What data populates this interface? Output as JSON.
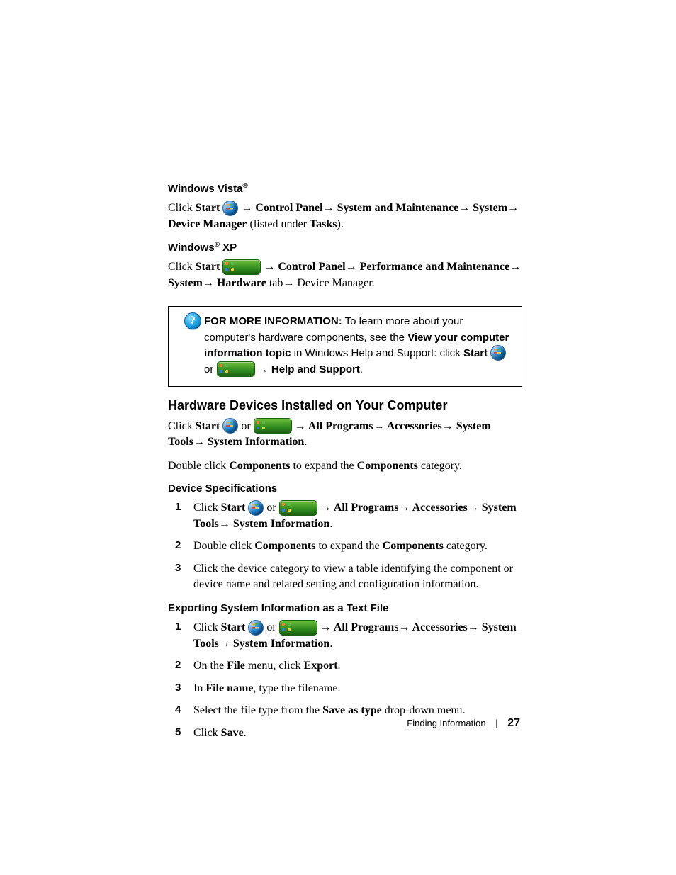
{
  "sections": {
    "vista_heading": "Windows Vista",
    "reg": "®",
    "click": "Click ",
    "start_bold": "Start",
    "vista_path": " → Control Panel→ System and Maintenance→ System→ Device Manager",
    "vista_tail": " (listed under ",
    "tasks_bold": "Tasks",
    "vista_tail2": ").",
    "xp_heading_pre": "Windows",
    "xp_heading_post": " XP",
    "xp_path1": " → Control Panel→ Performance and Maintenance→ System→ ",
    "hardware_bold": "Hardware",
    "xp_tab": " tab→ Device Manager."
  },
  "infobox": {
    "lead_bold": "FOR MORE INFORMATION:",
    "text1": " To learn more about your computer's hardware components, see the ",
    "link_bold": "View your computer information topic",
    "text2": " in Windows Help and Support: click ",
    "start": "Start",
    "or": " or ",
    "arrow": " → ",
    "help_bold": "Help and Support",
    "period": "."
  },
  "hardware": {
    "heading": "Hardware Devices Installed on Your Computer",
    "click": "Click ",
    "start": "Start",
    "or": "  or  ",
    "path": " → All Programs→ Accessories→ System Tools→ System Information",
    "period": ".",
    "dbl1": "Double click ",
    "components_bold": "Components",
    "dbl2": " to expand the ",
    "dbl3": " category."
  },
  "devspec": {
    "heading": "Device Specifications",
    "steps": {
      "s1_click": "Click ",
      "s1_start": "Start",
      "s1_or": "  or  ",
      "s1_path": " → All Programs→ Accessories→ System Tools→ System Information",
      "s1_period": ".",
      "s2a": "Double click ",
      "s2b": "Components",
      "s2c": " to expand the ",
      "s2d": "Components",
      "s2e": " category.",
      "s3": "Click the device category to view a table identifying the component or device name and related setting and configuration information."
    }
  },
  "export": {
    "heading": "Exporting System Information as a Text File",
    "s1_click": "Click ",
    "s1_start": "Start",
    "s1_or": "  or  ",
    "s1_path": " → All Programs→ Accessories→ System Tools→ System Information",
    "s1_period": ".",
    "s2a": "On the ",
    "s2b": "File",
    "s2c": " menu, click ",
    "s2d": "Export",
    "s2e": ".",
    "s3a": "In ",
    "s3b": "File name",
    "s3c": ", type the filename.",
    "s4a": "Select the file type from the ",
    "s4b": "Save as type",
    "s4c": " drop-down menu.",
    "s5a": "Click ",
    "s5b": "Save",
    "s5c": "."
  },
  "footer": {
    "section": "Finding Information",
    "page": "27"
  },
  "numbers": {
    "n1": "1",
    "n2": "2",
    "n3": "3",
    "n4": "4",
    "n5": "5"
  }
}
